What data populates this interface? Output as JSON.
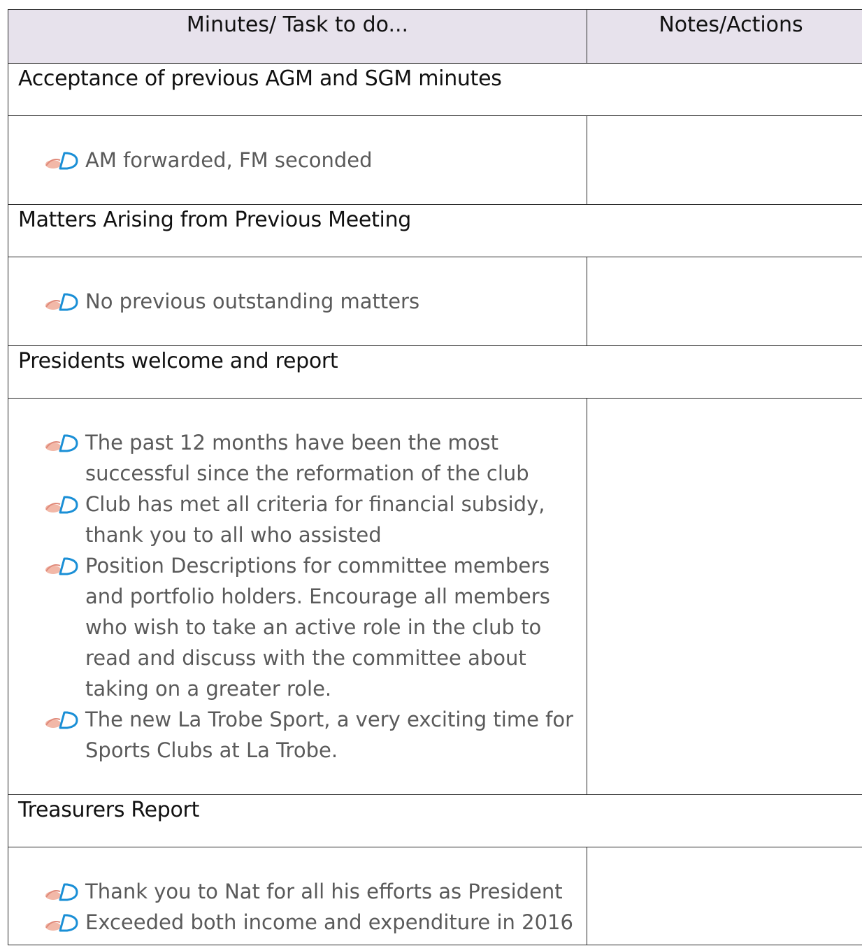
{
  "table": {
    "headers": {
      "minutes": "Minutes/ Task to do...",
      "notes": "Notes/Actions"
    },
    "sections": [
      {
        "title": "Acceptance of previous AGM and SGM minutes",
        "items": [
          "AM forwarded, FM seconded"
        ],
        "notes": ""
      },
      {
        "title": "Matters Arising from Previous Meeting",
        "items": [
          "No previous outstanding matters"
        ],
        "notes": ""
      },
      {
        "title": "Presidents welcome and report",
        "items": [
          "The past 12 months have been the most successful since the reformation of the club",
          "Club has met all criteria for financial subsidy, thank you to all who assisted",
          "Position Descriptions for committee members and portfolio holders. Encourage all members who wish to take an active role in the club to read and discuss with the committee about taking on a greater role.",
          "The new La Trobe Sport, a very exciting time for Sports Clubs at La Trobe."
        ],
        "notes": ""
      },
      {
        "title": "Treasurers Report",
        "items": [
          "Thank you to Nat for all his efforts as President",
          "Exceeded both income and expenditure in 2016"
        ],
        "notes": ""
      }
    ]
  },
  "icons": {
    "bullet": "hand-writing-pen-icon",
    "bullet_colors": {
      "pen": "#1a8fd6",
      "hand": "#f2b8a8"
    }
  },
  "colors": {
    "header_background": "#e7e2ec",
    "border": "#2a2a2a",
    "section_text": "#111111",
    "item_text": "#5a5a5a"
  }
}
